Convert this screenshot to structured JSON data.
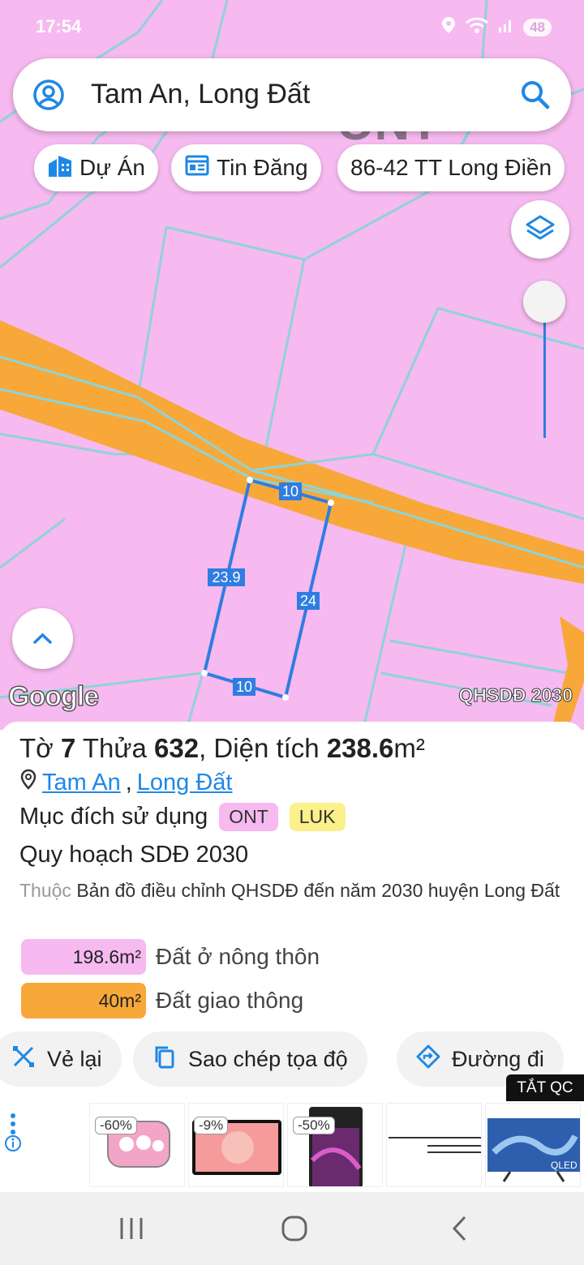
{
  "status": {
    "time": "17:54",
    "battery": "48"
  },
  "search": {
    "text": "Tam An, Long Đất"
  },
  "chips": [
    {
      "label": "Dự Án",
      "icon": "building-icon"
    },
    {
      "label": "Tin Đăng",
      "icon": "listing-icon"
    },
    {
      "label": "86-42 TT Long Điền"
    }
  ],
  "map": {
    "dimension_labels": [
      "10",
      "23.9",
      "24",
      "10"
    ],
    "attribution": "Google",
    "source_label": "QHSDĐ 2030",
    "background_text": "ONT",
    "colors": {
      "residential": "#f6b9f0",
      "road": "#f7a838",
      "parcel_line": "#8fd3d6",
      "selection": "#2f7de1"
    }
  },
  "parcel": {
    "title_prefix": "Tờ ",
    "sheet": "7",
    "plot_label": " Thửa ",
    "plot": "632",
    "area_label": ", Diện tích ",
    "area": "238.6",
    "area_unit": "m²",
    "commune": "Tam An",
    "district": "Long Đất",
    "purpose_label": "Mục đích sử dụng",
    "tags": [
      "ONT",
      "LUK"
    ],
    "plan_title": "Quy hoạch SDĐ 2030",
    "desc_prefix": "Thuộc",
    "desc": "Bản đồ điều chỉnh QHSDĐ đến năm 2030 huyện Long Đất",
    "landuse": [
      {
        "value": "198.6m²",
        "label": "Đất ở nông thôn",
        "color": "#f6b9f0"
      },
      {
        "value": "40m²",
        "label": "Đất giao thông",
        "color": "#f7a838"
      }
    ]
  },
  "actions": [
    {
      "label": "Vẻ lại",
      "icon": "redraw-icon"
    },
    {
      "label": "Sao chép tọa độ",
      "icon": "copy-icon"
    },
    {
      "label": "Đường đi",
      "icon": "directions-icon"
    }
  ],
  "ads": {
    "close_label": "TẮT QC",
    "items": [
      {
        "badge": "-60%"
      },
      {
        "badge": "-9%"
      },
      {
        "badge": "-50%"
      },
      {
        "badge": ""
      },
      {
        "badge": "",
        "brand": "QLED"
      }
    ]
  }
}
